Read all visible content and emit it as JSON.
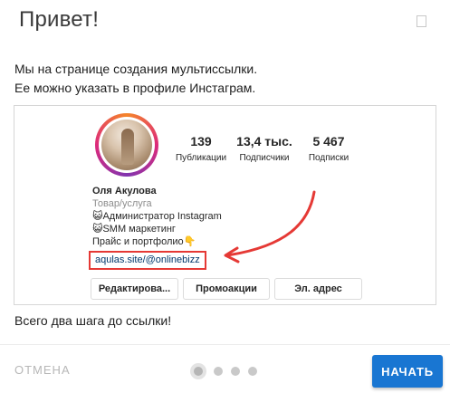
{
  "dialog": {
    "title": "Привет!",
    "intro_line1": "Мы на странице создания мультиссылки.",
    "intro_line2": "Ее можно указать в профиле Инстаграм.",
    "outro": "Всего два шага до ссылки!"
  },
  "profile": {
    "stats": [
      {
        "value": "139",
        "label": "Публикации"
      },
      {
        "value": "13,4 тыс.",
        "label": "Подписчики"
      },
      {
        "value": "5 467",
        "label": "Подписки"
      }
    ],
    "name": "Оля Акулова",
    "category": "Товар/услуга",
    "bio_lines": [
      "😺Администратор Instagram",
      "😺SMM маркетинг",
      "Прайс и портфолио👇"
    ],
    "link": "aqulas.site/@onlinebizz",
    "buttons": [
      "Редактирова...",
      "Промоакции",
      "Эл. адрес"
    ]
  },
  "footer": {
    "cancel_label": "ОТМЕНА",
    "start_label": "НАЧАТЬ",
    "steps_total": 4,
    "active_step": 1
  },
  "colors": {
    "primary": "#1976d2",
    "highlight": "#e53935",
    "cancel_text": "#b7b7b7"
  },
  "icons": {
    "close": "close-icon",
    "arrow": "red-arrow-annotation"
  }
}
